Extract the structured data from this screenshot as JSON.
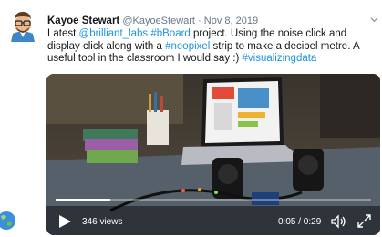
{
  "tweet": {
    "author_name": "Kayoe Stewart",
    "handle": "@KayoeStewart",
    "separator": " · ",
    "date": "Nov 8, 2019",
    "body": [
      {
        "text": "Latest ",
        "link": false
      },
      {
        "text": "@brilliant_labs",
        "link": true
      },
      {
        "text": " ",
        "link": false
      },
      {
        "text": "#bBoard",
        "link": true
      },
      {
        "text": " project. Using the noise click and display click along with a ",
        "link": false
      },
      {
        "text": "#neopixel",
        "link": true
      },
      {
        "text": " strip to make a decibel metre. A useful tool in the classroom I would say :) ",
        "link": false
      },
      {
        "text": "#visualizingdata",
        "link": true
      }
    ]
  },
  "video": {
    "views": "346 views",
    "time": "0:05 / 0:29",
    "progress": 0.172
  },
  "colors": {
    "link": "#1b95e0",
    "name": "#14171a",
    "meta": "#657786"
  },
  "icons": {
    "avatar": "avatar-cartoon-icon",
    "caret": "chevron-down-icon",
    "play": "play-icon",
    "volume": "volume-icon",
    "fullscreen": "fullscreen-icon",
    "globe": "globe-icon"
  }
}
